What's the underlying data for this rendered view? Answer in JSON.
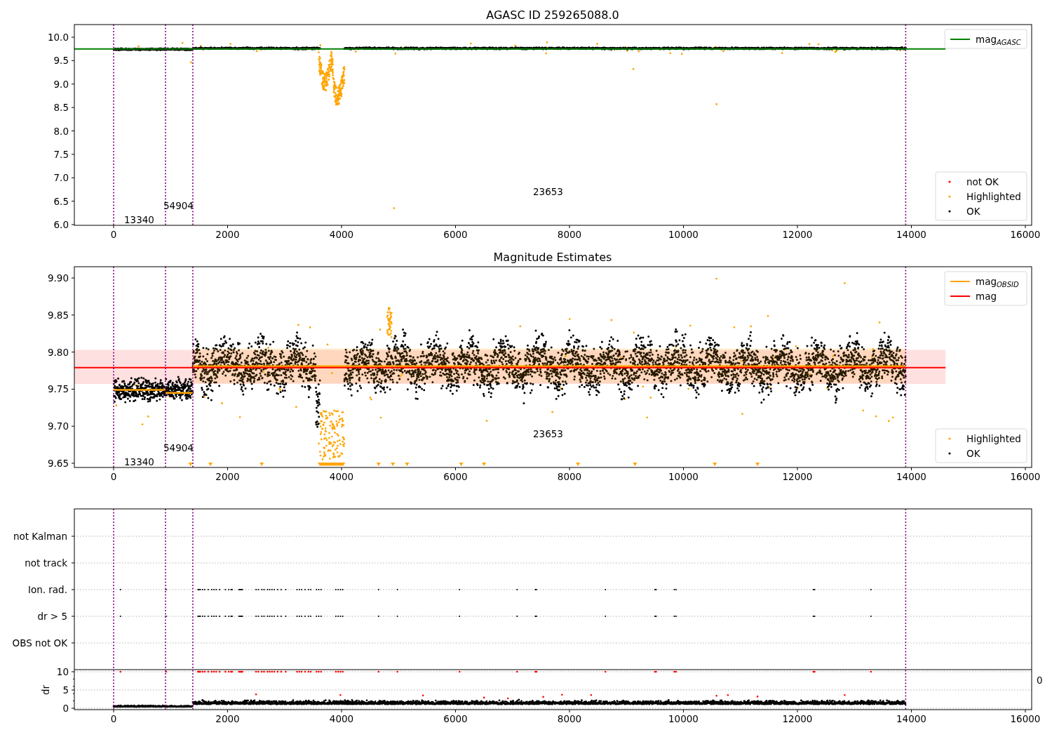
{
  "figure": {
    "panels": [
      {
        "kind": "mag",
        "title": "AGASC ID 259265088.0",
        "yticks": [
          "10.0",
          "9.5",
          "9.0",
          "8.5",
          "8.0",
          "7.5",
          "7.0",
          "6.5",
          "6.0"
        ],
        "xticks": [
          "0",
          "2000",
          "4000",
          "6000",
          "8000",
          "10000",
          "12000",
          "14000",
          "16000"
        ],
        "annotations": [
          {
            "text": "13340",
            "kind": "low"
          },
          {
            "text": "54904",
            "kind": "mid"
          },
          {
            "text": "23653",
            "kind": "high"
          }
        ],
        "legends": [
          {
            "entries": [
              {
                "kind": "line",
                "label": "mag",
                "subscript": "AGASC",
                "color": "#008000"
              }
            ]
          },
          {
            "entries": [
              {
                "kind": "dot",
                "label": "not OK",
                "color": "#ff0000"
              },
              {
                "kind": "dot",
                "label": "Highlighted",
                "color": "#ffa500"
              },
              {
                "kind": "dot",
                "label": "OK",
                "color": "#000000"
              }
            ]
          }
        ]
      },
      {
        "kind": "estimate",
        "title": "Magnitude Estimates",
        "yticks": [
          "9.90",
          "9.85",
          "9.80",
          "9.75",
          "9.70",
          "9.65"
        ],
        "xticks": [
          "0",
          "2000",
          "4000",
          "6000",
          "8000",
          "10000",
          "12000",
          "14000",
          "16000"
        ],
        "annotations": [
          {
            "text": "13340",
            "kind": "low"
          },
          {
            "text": "54904",
            "kind": "mid"
          },
          {
            "text": "23653",
            "kind": "high"
          }
        ],
        "legends": [
          {
            "entries": [
              {
                "kind": "line",
                "label": "mag",
                "subscript": "OBSID",
                "color": "#ffa500"
              },
              {
                "kind": "line",
                "label": "mag",
                "color": "#ff0000"
              }
            ]
          },
          {
            "entries": [
              {
                "kind": "dot",
                "label": "Highlighted",
                "color": "#ffa500"
              },
              {
                "kind": "dot",
                "label": "OK",
                "color": "#000000"
              }
            ]
          }
        ]
      },
      {
        "kind": "flags",
        "categories": [
          "not Kalman",
          "not track",
          "Ion. rad.",
          "dr > 5",
          "OBS not OK"
        ],
        "ylabel": "dr",
        "yticks": [
          "10",
          "5",
          "0"
        ],
        "xticks": [
          "0",
          "2000",
          "4000",
          "6000",
          "8000",
          "10000",
          "12000",
          "14000",
          "16000"
        ],
        "edge_label": "0"
      }
    ]
  }
}
